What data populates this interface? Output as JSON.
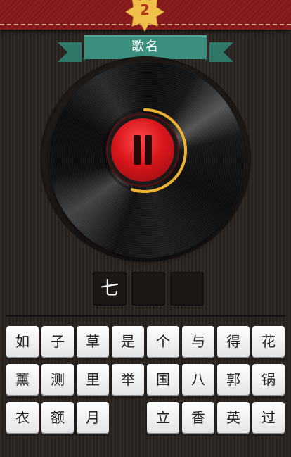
{
  "header": {
    "level": "2"
  },
  "ribbon": {
    "title": "歌名"
  },
  "player": {
    "state": "paused",
    "progress": 0.55
  },
  "answer": {
    "slots": [
      "七",
      "",
      ""
    ]
  },
  "keyboard": {
    "rows": [
      [
        "如",
        "子",
        "草",
        "是",
        "个",
        "与",
        "得",
        "花"
      ],
      [
        "薰",
        "测",
        "里",
        "举",
        "国",
        "八",
        "郭",
        "锅"
      ],
      [
        "衣",
        "额",
        "月",
        "",
        "立",
        "香",
        "英",
        "过"
      ]
    ]
  },
  "colors": {
    "header_red": "#8e1c1f",
    "ribbon_teal": "#3a8f7e",
    "badge_gold": "#f1c04a",
    "record_button_red": "#d8161c",
    "progress_gold": "#f0b232"
  }
}
